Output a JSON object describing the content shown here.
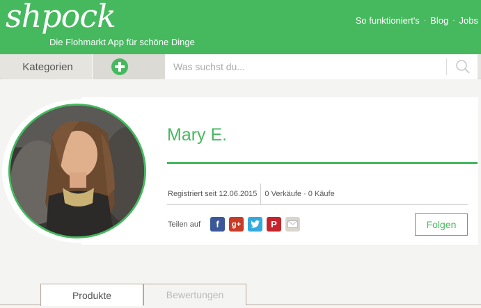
{
  "header": {
    "logo": "shpock",
    "tagline": "Die Flohmarkt App für schöne Dinge",
    "nav": [
      "So funktioniert's",
      "Blog",
      "Jobs"
    ],
    "nav_separator": "·"
  },
  "searchbar": {
    "categories_label": "Kategorien",
    "add_icon": "plus-circle-icon",
    "placeholder": "Was suchst du...",
    "search_icon": "magnifier-icon"
  },
  "profile": {
    "name": "Mary E.",
    "registered": "Registriert seit 12.06.2015",
    "sales_purchases": "0 Verkäufe · 0 Käufe",
    "share_label": "Teilen auf",
    "share_icons": [
      {
        "icon": "facebook-icon",
        "glyph": "f"
      },
      {
        "icon": "google-plus-icon",
        "glyph": "g+"
      },
      {
        "icon": "twitter-icon",
        "glyph": ""
      },
      {
        "icon": "pinterest-icon",
        "glyph": "P"
      },
      {
        "icon": "mail-icon",
        "glyph": ""
      }
    ],
    "follow_label": "Folgen"
  },
  "tabs": [
    {
      "label": "Produkte",
      "active": true
    },
    {
      "label": "Bewertungen",
      "active": false
    }
  ],
  "colors": {
    "brand_green": "#46b95f"
  }
}
